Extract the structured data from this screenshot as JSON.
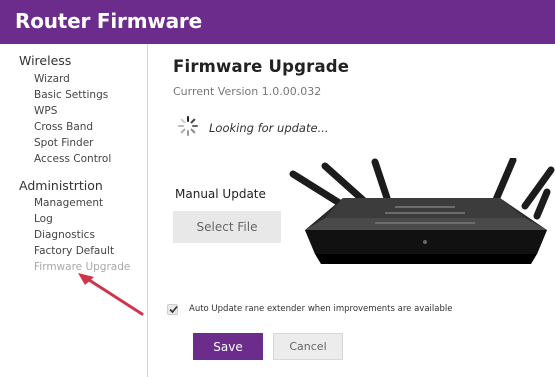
{
  "app": {
    "title": "Router Firmware"
  },
  "sidebar": {
    "sections": [
      {
        "title": "Wireless",
        "items": [
          "Wizard",
          "Basic Settings",
          "WPS",
          "Cross Band",
          "Spot Finder",
          "Access Control"
        ]
      },
      {
        "title": "Administrtion",
        "items": [
          "Management",
          "Log",
          "Diagnostics",
          "Factory Default",
          "Firmware Upgrade"
        ]
      }
    ],
    "active_item": "Firmware Upgrade"
  },
  "main": {
    "title": "Firmware Upgrade",
    "current_version": "Current Version 1.0.00.032",
    "status_text": "Looking for update...",
    "manual_update_label": "Manual Update",
    "select_file_label": "Select File",
    "auto_update": {
      "checked": true,
      "label": "Auto Update rane extender when improvements are available"
    },
    "save_label": "Save",
    "cancel_label": "Cancel"
  },
  "colors": {
    "brand": "#6b2c8c",
    "annotation_arrow": "#d0344a",
    "inactive_text": "#a9a9a9"
  },
  "icons": {
    "spinner": "loading-spinner-icon",
    "checkbox": "check-icon",
    "arrow": "annotation-arrow"
  }
}
